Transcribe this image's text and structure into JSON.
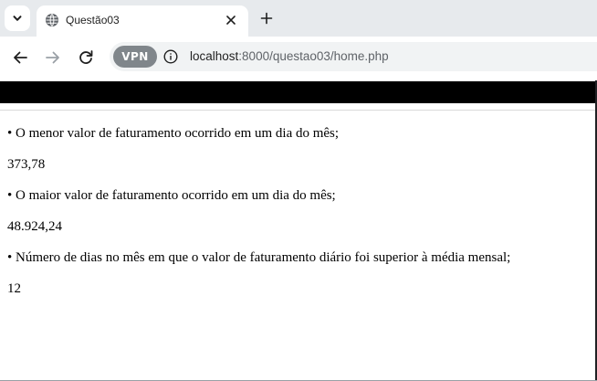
{
  "tab": {
    "title": "Questão03",
    "favicon": "globe-icon"
  },
  "toolbar": {
    "vpn_label": "VPN",
    "url_host": "localhost",
    "url_path": ":8000/questao03/home.php"
  },
  "icons": {
    "tab_search": "chevron-down-icon",
    "close": "close-icon",
    "new_tab": "plus-icon",
    "back": "arrow-left-icon",
    "forward": "arrow-right-icon",
    "reload": "reload-icon",
    "site_info": "info-icon"
  },
  "content": {
    "items": [
      {
        "text": "• O menor valor de faturamento ocorrido em um dia do mês;"
      },
      {
        "text": "373,78"
      },
      {
        "text": "• O maior valor de faturamento ocorrido em um dia do mês;"
      },
      {
        "text": "48.924,24"
      },
      {
        "text": "• Número de dias no mês em que o valor de faturamento diário foi superior à média mensal;"
      },
      {
        "text": "12"
      }
    ]
  },
  "colors": {
    "tabstrip": "#e7eaed",
    "omnibox": "#f1f3f4",
    "page_topbar": "#000000",
    "vpn_badge": "#80868b"
  }
}
